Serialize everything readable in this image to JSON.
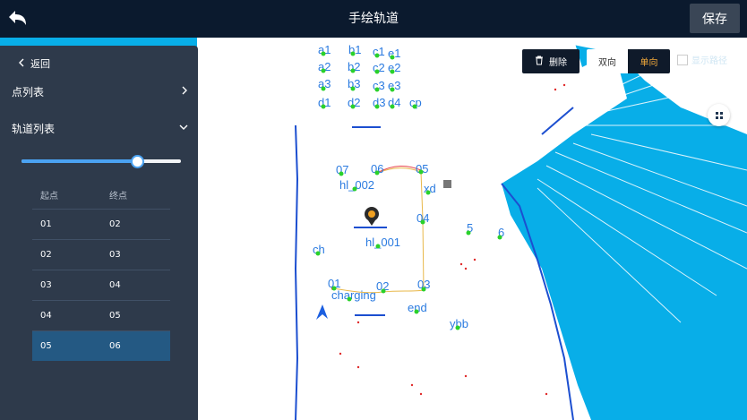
{
  "header": {
    "title": "手绘轨道",
    "save_label": "保存"
  },
  "panel": {
    "back_label": "返回",
    "point_list_label": "点列表",
    "track_list_label": "轨道列表",
    "slider_value_fraction": 0.72,
    "columns": [
      "起点",
      "终点"
    ],
    "rows": [
      {
        "start": "01",
        "end": "02"
      },
      {
        "start": "02",
        "end": "03"
      },
      {
        "start": "03",
        "end": "04"
      },
      {
        "start": "04",
        "end": "05"
      },
      {
        "start": "05",
        "end": "06"
      }
    ],
    "selected_row": 4
  },
  "toolbar": {
    "delete_label": "删除",
    "bidirectional_label": "双向",
    "unidirectional_label": "单向",
    "active_mode": "单向",
    "checkbox_label": "显示路径"
  },
  "map": {
    "points": [
      "a1",
      "b1",
      "c1",
      "e1",
      "a2",
      "b2",
      "c2",
      "e2",
      "a3",
      "b3",
      "c3",
      "e3",
      "d1",
      "d2",
      "d3",
      "d4",
      "cp",
      "07",
      "06",
      "05",
      "hl_002",
      "xd",
      "04",
      "5",
      "6",
      "ch",
      "hl_001",
      "01",
      "02",
      "03",
      "charging",
      "end",
      "ybb"
    ]
  },
  "colors": {
    "accent": "#4aa2f2",
    "map_bg": "#08aee8",
    "header_bg": "#0b1a2e",
    "panel_bg": "#2e3a4b",
    "active": "#f2a93b"
  }
}
